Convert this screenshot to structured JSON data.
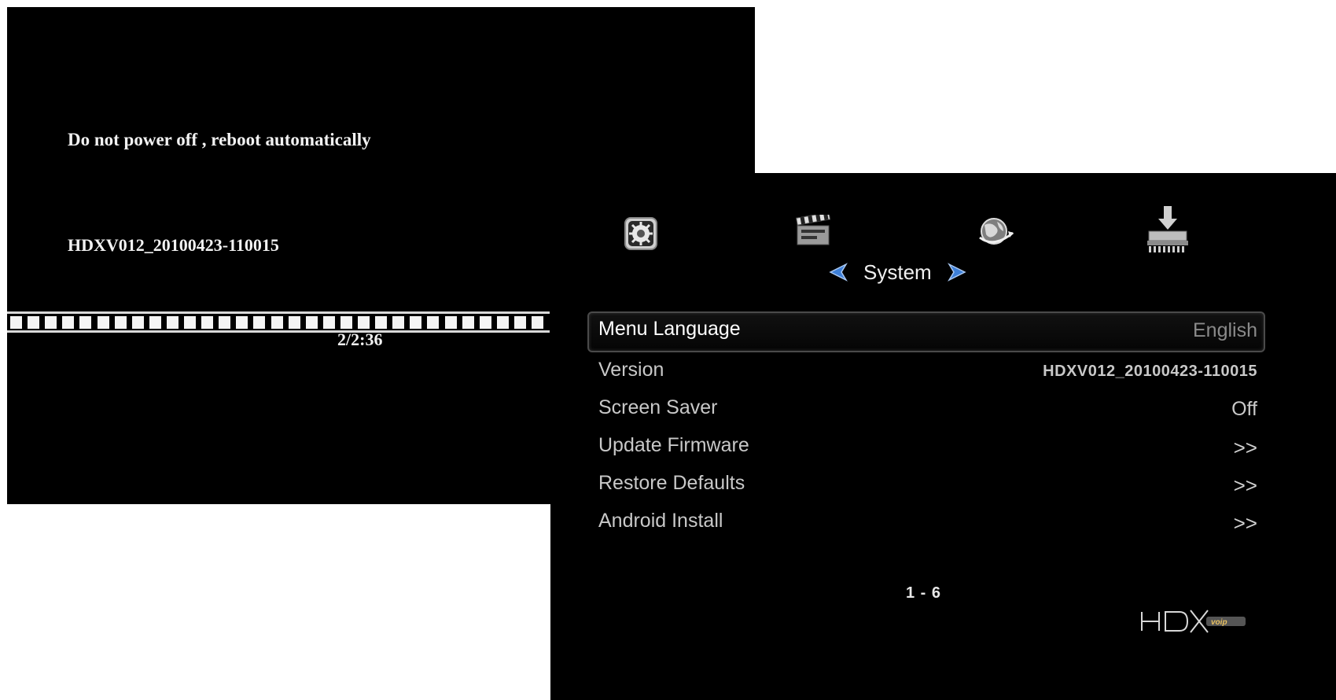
{
  "update_screen": {
    "message": "Do not power off , reboot automatically",
    "version": "HDXV012_20100423-110015",
    "progress_text": "2/2:36",
    "progress_segments": 31
  },
  "system_menu": {
    "section_title": "System",
    "top_icons": [
      "settings-box-icon",
      "movie-clapper-icon",
      "globe-network-icon",
      "download-tray-icon"
    ],
    "items": [
      {
        "label": "Menu Language",
        "value": "English"
      },
      {
        "label": "Version",
        "value": "HDXV012_20100423-110015"
      },
      {
        "label": "Screen Saver",
        "value": "Off"
      },
      {
        "label": "Update Firmware",
        "value": ">>"
      },
      {
        "label": "Restore Defaults",
        "value": ">>"
      },
      {
        "label": "Android Install",
        "value": ">>"
      }
    ],
    "page_indicator": "1 - 6",
    "brand_logo": "HDX voip",
    "colors": {
      "arrow": "#3d7fd8",
      "selected_border": "#4a4a4a"
    }
  }
}
